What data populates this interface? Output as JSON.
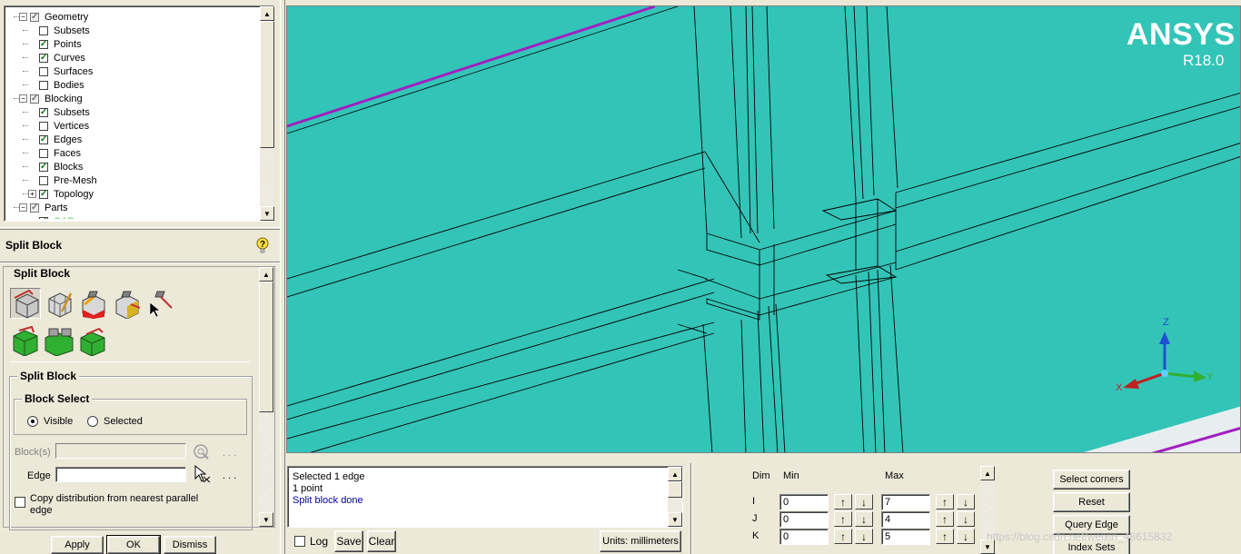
{
  "tree": {
    "items": [
      {
        "label": "Geometry",
        "level": 0,
        "expander": "−",
        "check": "grey"
      },
      {
        "label": "Subsets",
        "level": 1,
        "check": "off"
      },
      {
        "label": "Points",
        "level": 1,
        "check": "on"
      },
      {
        "label": "Curves",
        "level": 1,
        "check": "on"
      },
      {
        "label": "Surfaces",
        "level": 1,
        "check": "off"
      },
      {
        "label": "Bodies",
        "level": 1,
        "check": "off"
      },
      {
        "label": "Blocking",
        "level": 0,
        "expander": "−",
        "check": "grey"
      },
      {
        "label": "Subsets",
        "level": 1,
        "check": "on"
      },
      {
        "label": "Vertices",
        "level": 1,
        "check": "off"
      },
      {
        "label": "Edges",
        "level": 1,
        "check": "on"
      },
      {
        "label": "Faces",
        "level": 1,
        "check": "off"
      },
      {
        "label": "Blocks",
        "level": 1,
        "check": "on"
      },
      {
        "label": "Pre-Mesh",
        "level": 1,
        "check": "off"
      },
      {
        "label": "Topology",
        "level": 1,
        "expander": "+",
        "check": "on"
      },
      {
        "label": "Parts",
        "level": 0,
        "expander": "−",
        "check": "grey"
      },
      {
        "label": "CAD",
        "level": 1,
        "check": "on"
      }
    ]
  },
  "panel": {
    "title": "Split Block",
    "section_title": "Split Block",
    "tools": [
      {
        "icon": "split-block-icon"
      },
      {
        "icon": "split-face-icon"
      },
      {
        "icon": "split-edge-icon"
      },
      {
        "icon": "split-o-grid-icon"
      },
      {
        "icon": "split-cursor-icon"
      },
      {
        "icon": "split-ogrid-green-icon"
      },
      {
        "icon": "split-prism-icon"
      },
      {
        "icon": "split-merge-icon"
      }
    ],
    "inner_group": "Split Block",
    "block_select": {
      "title": "Block Select",
      "options": [
        "Visible",
        "Selected"
      ],
      "selected": "Visible"
    },
    "blocks_label": "Block(s)",
    "edge_label": "Edge",
    "dots": ". . .",
    "copy_dist": "Copy distribution from nearest parallel edge",
    "apply": "Apply",
    "ok": "OK",
    "dismiss": "Dismiss"
  },
  "viewport": {
    "brand": "ANSYS",
    "version": "R18.0",
    "background": "#33c4b8",
    "axes": {
      "z": "Z",
      "y": "Y",
      "x": "X"
    }
  },
  "messages": {
    "lines": [
      "Selected 1 edge",
      "1 point",
      "Split block done"
    ],
    "log": "Log",
    "save": "Save",
    "clear": "Clear",
    "units": "Units: millimeters"
  },
  "index": {
    "headers": {
      "dim": "Dim",
      "min": "Min",
      "max": "Max"
    },
    "rows": [
      {
        "dim": "I",
        "min": "0",
        "max": "7"
      },
      {
        "dim": "J",
        "min": "0",
        "max": "4"
      },
      {
        "dim": "K",
        "min": "0",
        "max": "5"
      }
    ],
    "buttons": [
      "Select corners",
      "Reset",
      "Query Edge",
      "Index Sets"
    ]
  },
  "watermark": "https://blog.csdn.net/weixin_48615832"
}
